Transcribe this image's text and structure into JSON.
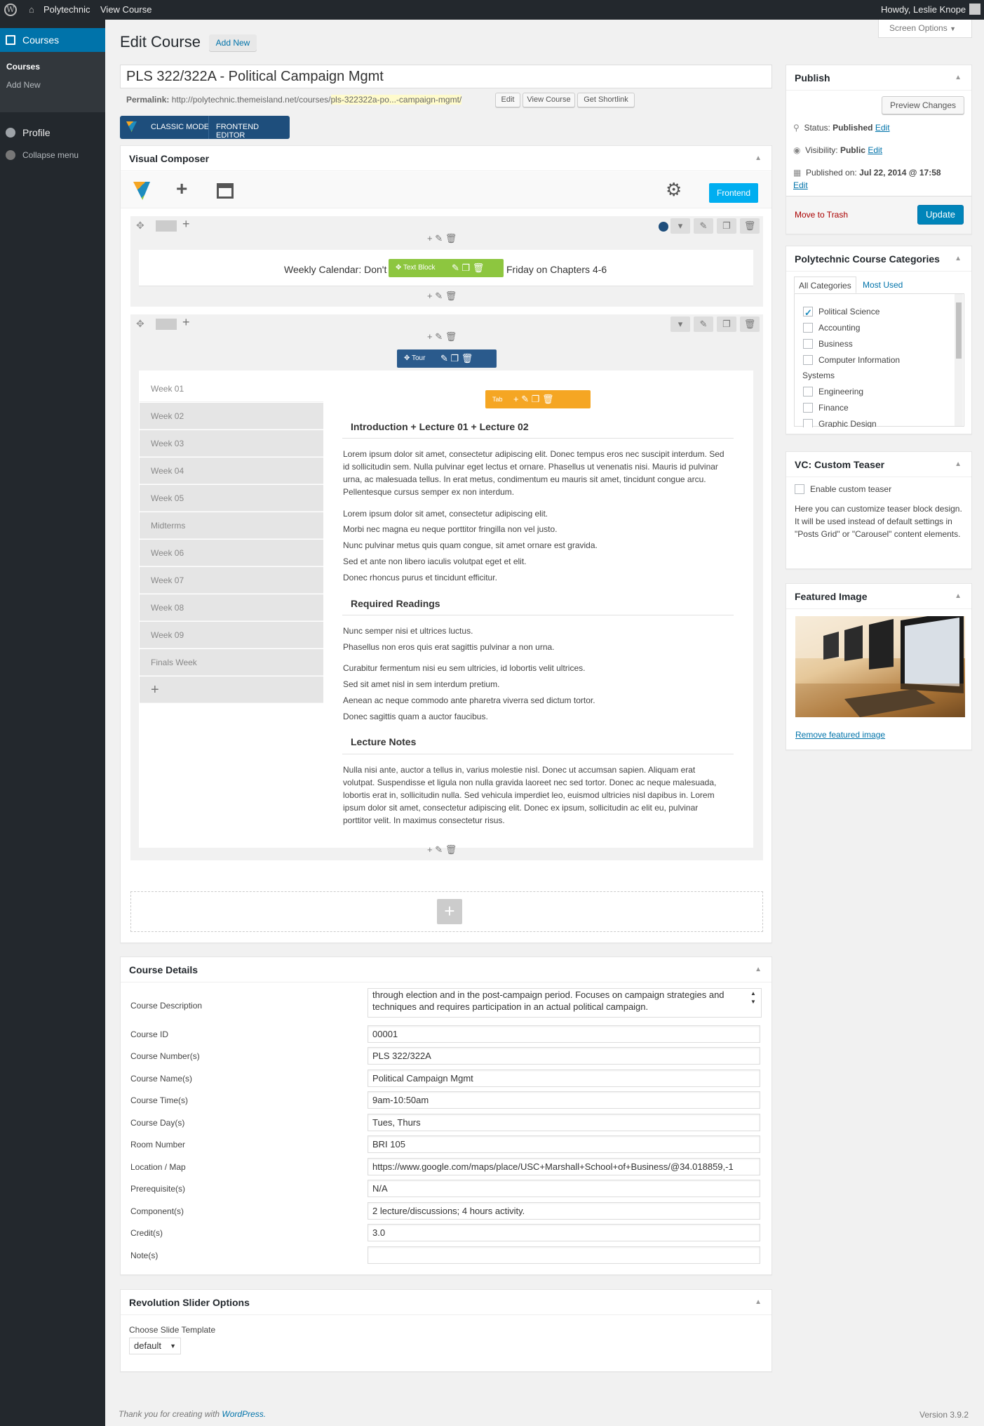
{
  "adminbar": {
    "site_name": "Polytechnic",
    "view_course": "View Course",
    "howdy": "Howdy, Leslie Knope"
  },
  "sidebar": {
    "courses_label": "Courses",
    "sub_items": [
      "Courses",
      "Add New"
    ],
    "profile_label": "Profile",
    "collapse_label": "Collapse menu"
  },
  "header": {
    "title": "Edit Course",
    "add_new": "Add New",
    "screen_options": "Screen Options"
  },
  "post": {
    "title": "PLS 322/322A - Political  Campaign  Mgmt",
    "permalink_label": "Permalink:",
    "permalink_base": "http://polytechnic.themeisland.net/courses/",
    "permalink_slug": "pls-322322a-po...-campaign-mgmt/",
    "permalink_buttons": [
      "Edit",
      "View Course",
      "Get Shortlink"
    ]
  },
  "editor_modes": {
    "classic": "CLASSIC MODE",
    "frontend": "FRONTEND EDITOR"
  },
  "vc": {
    "title": "Visual Composer",
    "frontend_btn": "Frontend",
    "row1_text": "Weekly Calendar: Don't",
    "row1_text_end": "Friday on Chapters 4-6",
    "text_block_label": "Text Block",
    "tour_label": "Tour",
    "tab_label": "Tab",
    "tabs": [
      "Week 01",
      "Week 02",
      "Week 03",
      "Week 04",
      "Week 05",
      "Midterms",
      "Week 06",
      "Week 07",
      "Week 08",
      "Week 09",
      "Finals Week"
    ],
    "add_tab": "+",
    "content": {
      "h1": "Introduction + Lecture 01 + Lecture 02",
      "p1": "Lorem ipsum dolor sit amet, consectetur adipiscing elit. Donec tempus eros nec suscipit interdum. Sed id sollicitudin sem. Nulla pulvinar eget lectus et ornare. Phasellus ut venenatis nisi. Mauris id pulvinar urna, ac malesuada tellus. In erat metus, condimentum eu mauris sit amet, tincidunt congue arcu. Pellentesque cursus semper ex non interdum.",
      "lines1": [
        "Lorem ipsum dolor sit amet, consectetur adipiscing elit.",
        "Morbi nec magna eu neque porttitor fringilla non vel justo.",
        "Nunc pulvinar metus quis quam congue, sit amet ornare est gravida.",
        "Sed et ante non libero iaculis volutpat eget et elit.",
        "Donec rhoncus purus et tincidunt efficitur."
      ],
      "h2": "Required Readings",
      "lines2a": [
        "Nunc semper nisi et ultrices luctus.",
        "Phasellus non eros quis erat sagittis pulvinar a non urna."
      ],
      "lines2b": [
        "Curabitur fermentum nisi eu sem ultricies, id lobortis velit ultrices.",
        "Sed sit amet nisl in sem interdum pretium.",
        "Aenean ac neque commodo ante pharetra viverra sed dictum tortor.",
        "Donec sagittis quam a auctor faucibus."
      ],
      "h3": "Lecture Notes",
      "p3": "Nulla nisi ante, auctor a tellus in, varius molestie nisl. Donec ut accumsan sapien. Aliquam erat volutpat. Suspendisse et ligula non nulla gravida laoreet nec sed tortor. Donec ac neque malesuada, lobortis erat in, sollicitudin nulla. Sed vehicula imperdiet leo, euismod ultricies nisl dapibus in. Lorem ipsum dolor sit amet, consectetur adipiscing elit. Donec ex ipsum, sollicitudin ac elit eu, pulvinar porttitor velit. In maximus consectetur risus."
    }
  },
  "course_details": {
    "title": "Course Details",
    "description_label": "Course Description",
    "description_value": "through election and in the post-campaign period. Focuses on campaign strategies and techniques and requires participation in an actual political campaign.",
    "fields": [
      {
        "label": "Course ID",
        "value": "00001"
      },
      {
        "label": "Course Number(s)",
        "value": "PLS 322/322A"
      },
      {
        "label": "Course Name(s)",
        "value": "Political  Campaign  Mgmt"
      },
      {
        "label": "Course Time(s)",
        "value": "9am-10:50am"
      },
      {
        "label": "Course Day(s)",
        "value": "Tues, Thurs"
      },
      {
        "label": "Room Number",
        "value": "BRI 105"
      },
      {
        "label": "Location / Map",
        "value": "https://www.google.com/maps/place/USC+Marshall+School+of+Business/@34.018859,-1"
      },
      {
        "label": "Prerequisite(s)",
        "value": "N/A"
      },
      {
        "label": "Component(s)",
        "value": "2 lecture/discussions; 4 hours activity."
      },
      {
        "label": "Credit(s)",
        "value": "3.0"
      },
      {
        "label": "Note(s)",
        "value": ""
      }
    ]
  },
  "rev_slider": {
    "title": "Revolution Slider Options",
    "template_label": "Choose Slide Template",
    "template_value": "default"
  },
  "publish": {
    "title": "Publish",
    "preview": "Preview Changes",
    "status_label": "Status:",
    "status_value": "Published",
    "visibility_label": "Visibility:",
    "visibility_value": "Public",
    "published_label": "Published on:",
    "published_value": "Jul 22, 2014 @ 17:58",
    "edit": "Edit",
    "trash": "Move to Trash",
    "update": "Update"
  },
  "categories": {
    "title": "Polytechnic Course Categories",
    "tab_all": "All Categories",
    "tab_used": "Most Used",
    "items": [
      {
        "label": "Political Science",
        "checked": true
      },
      {
        "label": "Accounting",
        "checked": false
      },
      {
        "label": "Business",
        "checked": false
      },
      {
        "label": "Computer Information",
        "checked": false
      },
      {
        "label": "Engineering",
        "checked": false
      },
      {
        "label": "Finance",
        "checked": false
      },
      {
        "label": "Graphic Design",
        "checked": false
      }
    ],
    "systems_label": "Systems"
  },
  "teaser": {
    "title": "VC: Custom Teaser",
    "enable": "Enable custom teaser",
    "desc": "Here you can customize teaser block design. It will be used instead of default settings in \"Posts Grid\" or \"Carousel\" content elements."
  },
  "featured": {
    "title": "Featured Image",
    "remove": "Remove featured image"
  },
  "footer": {
    "thanks": "Thank you for creating with",
    "wp_link": "WordPress.",
    "version": "Version 3.9.2"
  },
  "colors": {
    "wp_blue": "#0073aa",
    "vc_green": "#8dc63f",
    "vc_navy": "#2a5a8c",
    "vc_orange": "#f5a623",
    "frontend_cyan": "#00aef0"
  }
}
